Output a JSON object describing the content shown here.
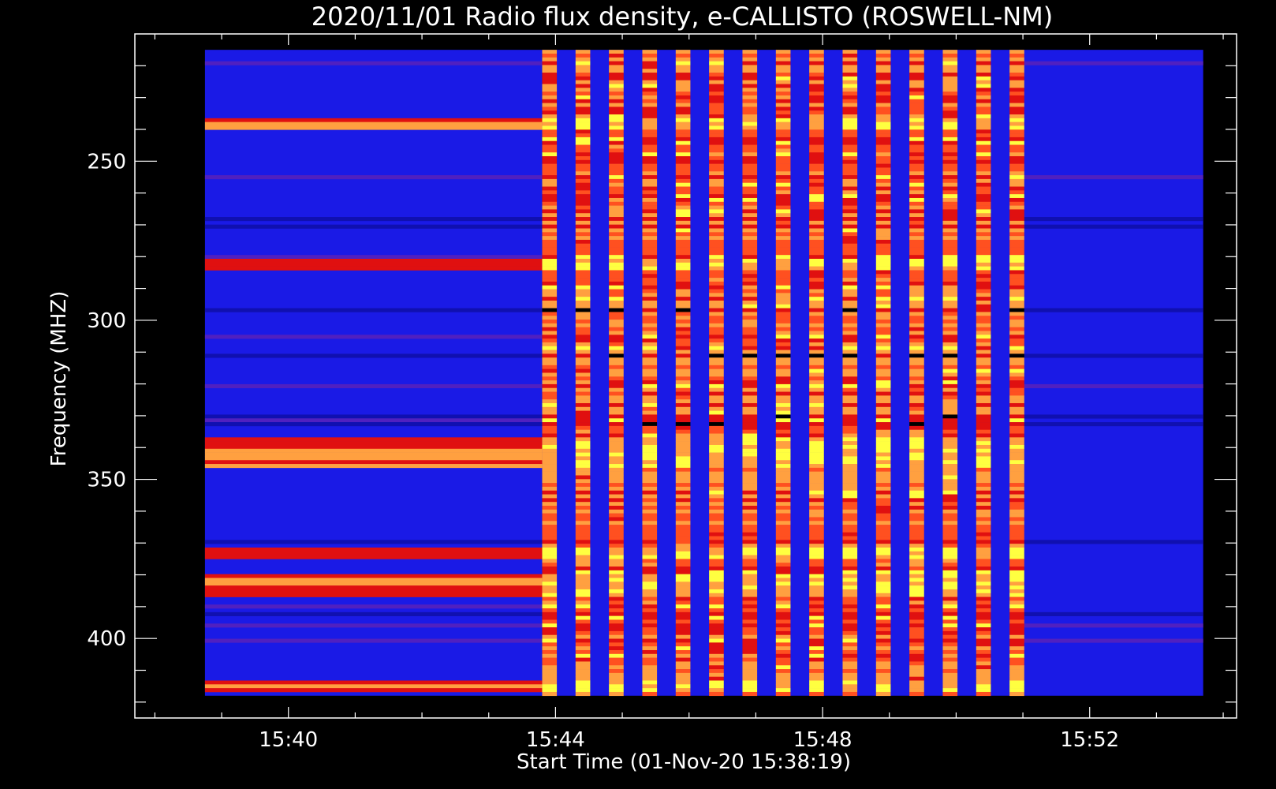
{
  "chart_data": {
    "type": "heatmap",
    "title": "2020/11/01  Radio flux density, e-CALLISTO (ROSWELL-NM)",
    "xlabel": "Start Time (01-Nov-20 15:38:19)",
    "ylabel": "Frequency (MHZ)",
    "x_ticks": [
      "15:40",
      "15:44",
      "15:48",
      "15:52"
    ],
    "x_tick_minutes": [
      2,
      6,
      10,
      14
    ],
    "y_ticks": [
      250,
      300,
      350,
      400
    ],
    "xlim_minutes_from_15_38": [
      -0.3,
      16.2
    ],
    "ylim_mhz": [
      210,
      425
    ],
    "y_axis_inverted": true,
    "data_extent": {
      "start_minutes_from_15_38": 0.75,
      "end_minutes_from_15_38": 15.7,
      "freq_top_mhz": 215,
      "freq_bottom_mhz": 418
    },
    "segments": [
      {
        "name": "quiet",
        "from_min": 0.75,
        "to_min": 5.8
      },
      {
        "name": "interference",
        "from_min": 5.8,
        "to_min": 13.0
      },
      {
        "name": "quiet",
        "from_min": 13.0,
        "to_min": 15.7
      }
    ],
    "interference_stripe_start_minutes": [
      5.8,
      6.3,
      6.8,
      7.3,
      7.8,
      8.3,
      8.8,
      9.3,
      9.8,
      10.3,
      10.8,
      11.3,
      11.8,
      12.3,
      12.8
    ],
    "interference_stripe_width_minutes": 0.22,
    "bright_bands_mhz": [
      238,
      282,
      338,
      341,
      344,
      373,
      381,
      385,
      415
    ],
    "colors": {
      "background": "#000000",
      "low": "#1a1ae6",
      "mid": "#e01010",
      "high": "#ffa040",
      "peak": "#ffff40",
      "axes": "#ffffff"
    }
  }
}
